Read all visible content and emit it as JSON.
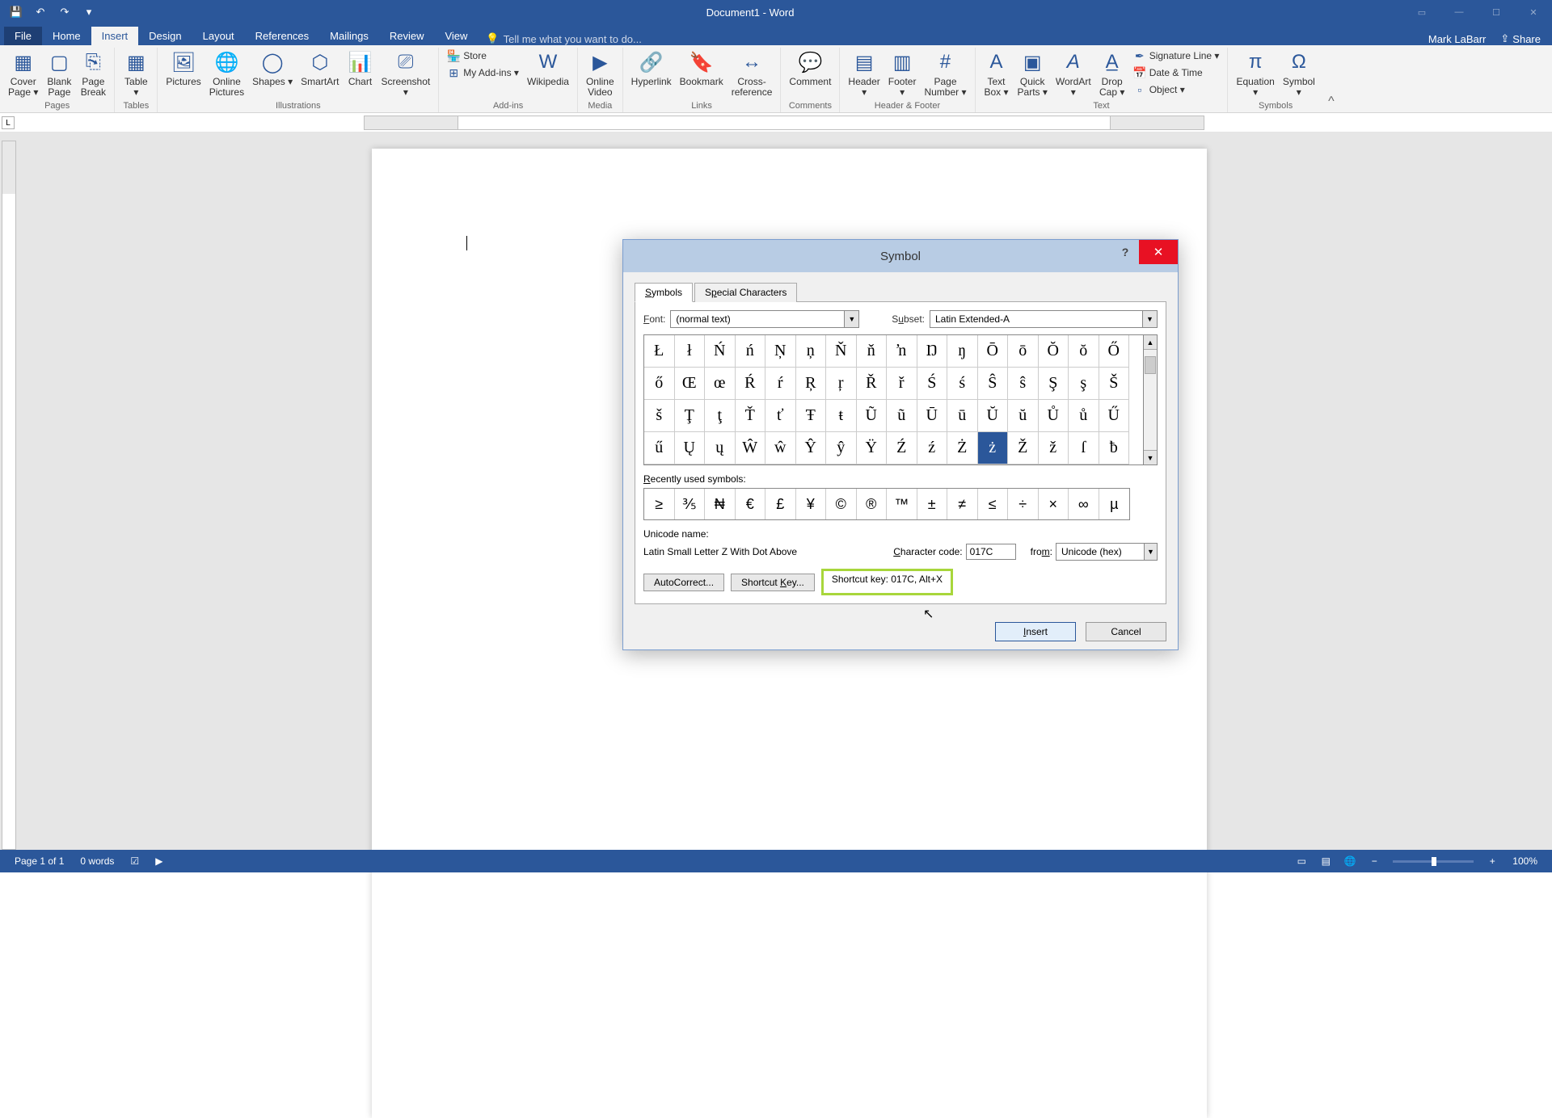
{
  "title_bar": {
    "document_title": "Document1 - Word",
    "qat": {
      "save": "💾",
      "undo": "↶",
      "redo": "↷",
      "customize": "▾"
    }
  },
  "ribbon_tabs": {
    "file": "File",
    "home": "Home",
    "insert": "Insert",
    "design": "Design",
    "layout": "Layout",
    "references": "References",
    "mailings": "Mailings",
    "review": "Review",
    "view": "View",
    "tell_me_placeholder": "Tell me what you want to do..."
  },
  "user": {
    "name": "Mark LaBarr",
    "share": "Share"
  },
  "ribbon": {
    "groups": {
      "pages": {
        "label": "Pages",
        "cover": "Cover\nPage ▾",
        "blank": "Blank\nPage",
        "break": "Page\nBreak"
      },
      "tables": {
        "label": "Tables",
        "table": "Table\n▾"
      },
      "illustrations": {
        "label": "Illustrations",
        "pictures": "Pictures",
        "online_pics": "Online\nPictures",
        "shapes": "Shapes ▾",
        "smartart": "SmartArt",
        "chart": "Chart",
        "screenshot": "Screenshot\n▾"
      },
      "addins": {
        "label": "Add-ins",
        "store": "Store",
        "myaddins": "My Add-ins ▾",
        "wikipedia": "Wikipedia"
      },
      "media": {
        "label": "Media",
        "online_video": "Online\nVideo"
      },
      "links": {
        "label": "Links",
        "hyperlink": "Hyperlink",
        "bookmark": "Bookmark",
        "crossref": "Cross-\nreference"
      },
      "comments": {
        "label": "Comments",
        "comment": "Comment"
      },
      "hf": {
        "label": "Header & Footer",
        "header": "Header\n▾",
        "footer": "Footer\n▾",
        "pagenum": "Page\nNumber ▾"
      },
      "text": {
        "label": "Text",
        "textbox": "Text\nBox ▾",
        "quick": "Quick\nParts ▾",
        "wordart": "WordArt\n▾",
        "drop": "Drop\nCap ▾",
        "sig": "Signature Line ▾",
        "dt": "Date & Time",
        "obj": "Object ▾"
      },
      "symbols": {
        "label": "Symbols",
        "equation": "Equation\n▾",
        "symbol": "Symbol\n▾"
      }
    }
  },
  "dialog": {
    "title": "Symbol",
    "tabs": {
      "symbols": "Symbols",
      "special": "Special Characters"
    },
    "font_label": "Font:",
    "font_value": "(normal text)",
    "subset_label": "Subset:",
    "subset_value": "Latin Extended-A",
    "grid": [
      [
        "Ł",
        "ł",
        "Ń",
        "ń",
        "Ņ",
        "ņ",
        "Ň",
        "ň",
        "ŉ",
        "Ŋ",
        "ŋ",
        "Ō",
        "ō",
        "Ŏ",
        "ŏ",
        "Ő"
      ],
      [
        "ő",
        "Œ",
        "œ",
        "Ŕ",
        "ŕ",
        "Ŗ",
        "ŗ",
        "Ř",
        "ř",
        "Ś",
        "ś",
        "Ŝ",
        "ŝ",
        "Ş",
        "ş",
        "Š"
      ],
      [
        "š",
        "Ţ",
        "ţ",
        "Ť",
        "ť",
        "Ŧ",
        "ŧ",
        "Ũ",
        "ũ",
        "Ū",
        "ū",
        "Ŭ",
        "ŭ",
        "Ů",
        "ů",
        "Ű"
      ],
      [
        "ű",
        "Ų",
        "ų",
        "Ŵ",
        "ŵ",
        "Ŷ",
        "ŷ",
        "Ÿ",
        "Ź",
        "ź",
        "Ż",
        "ż",
        "Ž",
        "ž",
        "ſ",
        "ƀ"
      ]
    ],
    "selected_row": 3,
    "selected_col": 11,
    "recent_label": "Recently used symbols:",
    "recent": [
      "≥",
      "⅗",
      "₦",
      "€",
      "£",
      "¥",
      "©",
      "®",
      "™",
      "±",
      "≠",
      "≤",
      "÷",
      "×",
      "∞",
      "µ"
    ],
    "unicode_name_label": "Unicode name:",
    "unicode_name": "Latin Small Letter Z With Dot Above",
    "char_code_label": "Character code:",
    "char_code": "017C",
    "from_label": "from:",
    "from_value": "Unicode (hex)",
    "autocorrect": "AutoCorrect...",
    "shortcut_key_btn": "Shortcut Key...",
    "shortcut_info": "Shortcut key: 017C, Alt+X",
    "insert": "Insert",
    "cancel": "Cancel"
  },
  "status": {
    "page": "Page 1 of 1",
    "words": "0 words",
    "zoom": "100%"
  }
}
